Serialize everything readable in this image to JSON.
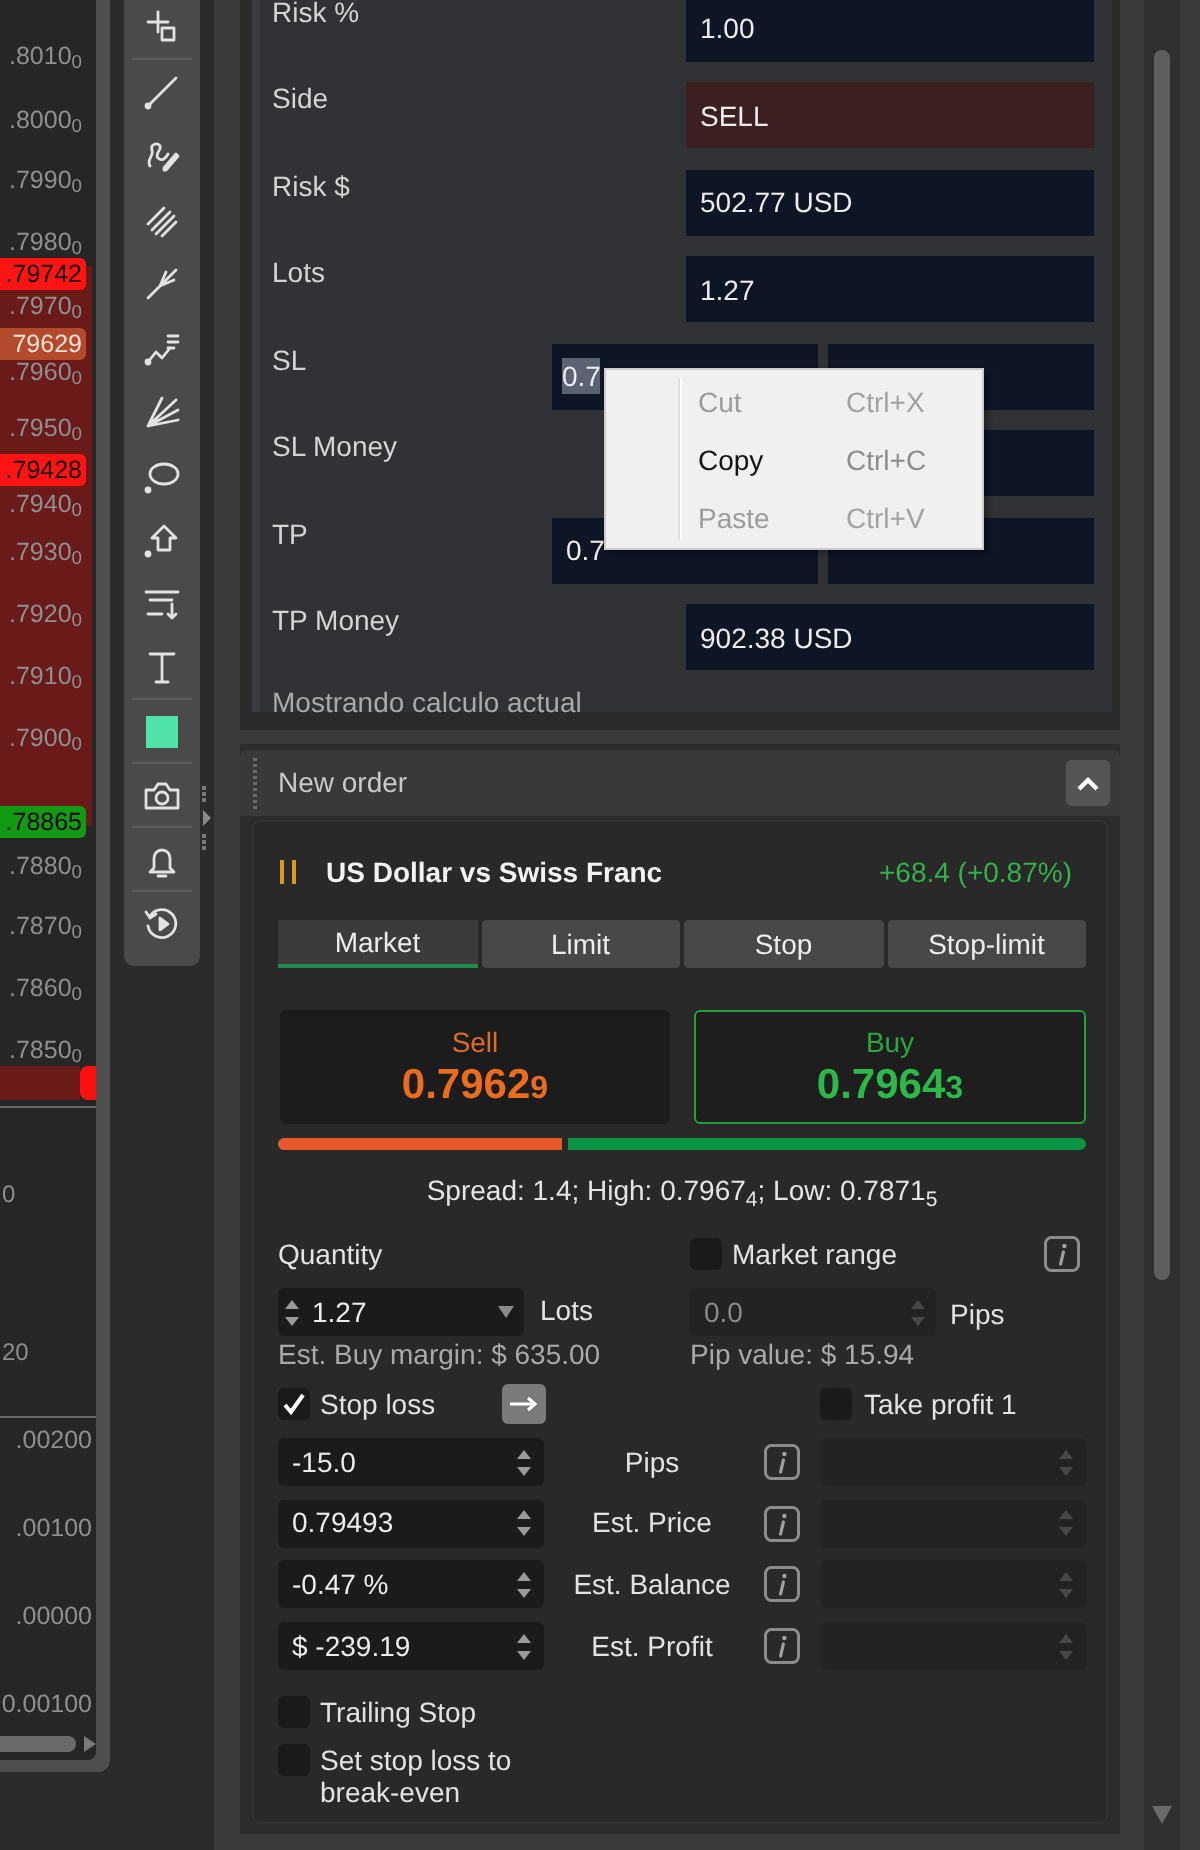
{
  "chart": {
    "price_ticks": [
      ".8010$_{0}$",
      ".8000$_{0}$",
      ".7990$_{0}$",
      ".7980$_{0}$",
      ".7970$_{0}$",
      ".7960$_{0}$",
      ".7950$_{0}$",
      ".7940$_{0}$",
      ".7930$_{0}$",
      ".7920$_{0}$",
      ".7910$_{0}$",
      ".7900$_{0}$",
      ".7880$_{0}$",
      ".7870$_{0}$",
      ".7860$_{0}$",
      ".7850$_{0}$"
    ],
    "price_badges": [
      {
        "label": ".79742",
        "kind": "line",
        "color": "#ff1414"
      },
      {
        "label": "79629",
        "kind": "current",
        "color": "#b44a2c"
      },
      {
        "label": ".79428",
        "kind": "line",
        "color": "#ff1414"
      },
      {
        "label": ".78865",
        "kind": "line",
        "color": "#139a13"
      }
    ],
    "oscillator_ticks": [
      "0",
      "20"
    ],
    "indicator_ticks": [
      ".00200",
      ".00100",
      ".00000",
      "0.00100"
    ]
  },
  "risk_calculator": {
    "rows": [
      {
        "label": "Risk %",
        "kind": "single",
        "value": "1.00",
        "text_selected": false
      },
      {
        "label": "Side",
        "kind": "side",
        "value": "SELL",
        "text_selected": false
      },
      {
        "label": "Risk $",
        "kind": "single",
        "value": "502.77 USD",
        "text_selected": false
      },
      {
        "label": "Lots",
        "kind": "single",
        "value": "1.27",
        "text_selected": false
      },
      {
        "label": "SL",
        "kind": "pair",
        "value": "0.7",
        "text_selected": true
      },
      {
        "label": "SL Money",
        "kind": "single"
      },
      {
        "label": "TP",
        "kind": "pair",
        "value": "0.7",
        "text_selected": false
      },
      {
        "label": "TP Money",
        "kind": "single",
        "value": "902.38 USD",
        "text_selected": false
      }
    ],
    "note": "Mostrando calculo actual"
  },
  "context_menu": {
    "items": [
      {
        "label": "Cut",
        "shortcut": "Ctrl+X",
        "disabled": true
      },
      {
        "label": "Copy",
        "shortcut": "Ctrl+C",
        "disabled": false
      },
      {
        "label": "Paste",
        "shortcut": "Ctrl+V",
        "disabled": true
      }
    ]
  },
  "new_order": {
    "title": "New order",
    "expanded": true,
    "instrument": {
      "name": "US Dollar vs Swiss Franc",
      "change": "+68.4 (+0.87%)"
    },
    "order_types": [
      {
        "label": "Market",
        "selected": true
      },
      {
        "label": "Limit",
        "selected": false
      },
      {
        "label": "Stop",
        "selected": false
      },
      {
        "label": "Stop-limit",
        "selected": false
      }
    ],
    "quotes": [
      {
        "kind": "sell",
        "label": "Sell",
        "price": "0.7962",
        "last_digit": "9",
        "selected": false
      },
      {
        "kind": "buy",
        "label": "Buy",
        "price": "0.7964",
        "last_digit": "3",
        "selected": true
      }
    ],
    "ratio_bar": {
      "level": 0.36
    },
    "spread": "Spread: 1.4; High: 0.7967$_{4}$; Low: 0.7871$_{5}$",
    "quantity": {
      "label": "Quantity",
      "value": "1.27",
      "unit": "Lots",
      "margin": "Est. Buy margin: $ 635.00"
    },
    "market_range": {
      "label": "Market range",
      "checked": false,
      "value": "0.0",
      "unit": "Pips",
      "pip_value": "Pip value: $ 15.94"
    },
    "stop_loss": {
      "label": "Stop loss",
      "checked": true,
      "rows": [
        {
          "value": "-15.0",
          "label": "Pips"
        },
        {
          "value": "0.79493",
          "label": "Est. Price"
        },
        {
          "value": "-0.47 %",
          "label": "Est. Balance"
        },
        {
          "value": "$ -239.19",
          "label": "Est. Profit"
        }
      ]
    },
    "take_profit": {
      "label": "Take profit 1",
      "checked": false
    },
    "options": [
      {
        "label": "Trailing Stop",
        "checked": false
      },
      {
        "label": "Set stop loss to break-even",
        "checked": false
      }
    ]
  }
}
